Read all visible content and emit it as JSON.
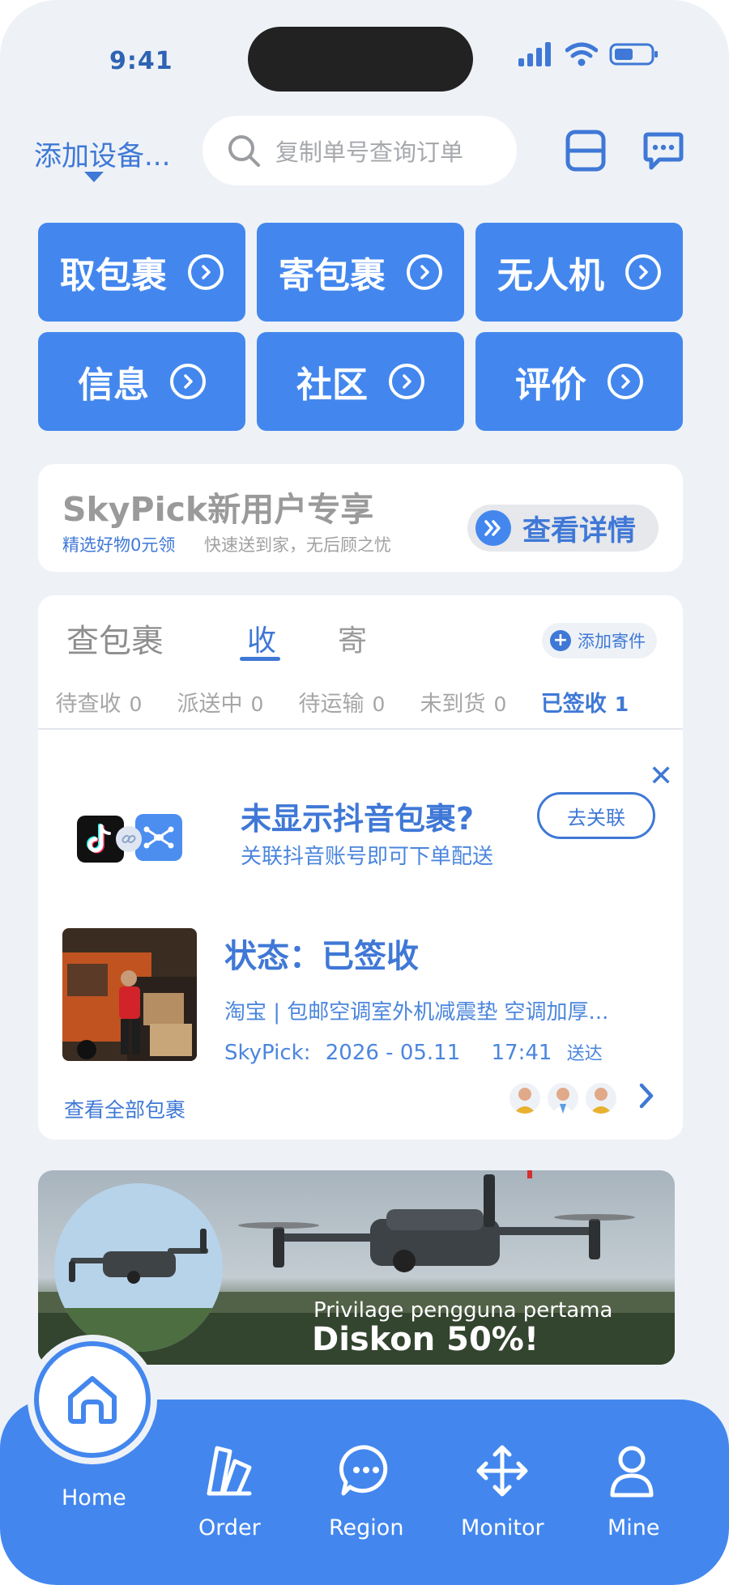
{
  "status_bar": {
    "time": "9:41"
  },
  "top_bar": {
    "add_device": "添加设备...",
    "search_placeholder": "复制单号查询订单"
  },
  "quick_actions": [
    {
      "label": "取包裹"
    },
    {
      "label": "寄包裹"
    },
    {
      "label": "无人机"
    },
    {
      "label": "信息"
    },
    {
      "label": "社区"
    },
    {
      "label": "评价"
    }
  ],
  "promo": {
    "title": "SkyPick新用户专享",
    "subtitle_highlight": "精选好物0元领",
    "subtitle": "快速送到家，无后顾之忧",
    "button": "查看详情"
  },
  "packages": {
    "title": "查包裹",
    "tabs": [
      {
        "label": "收",
        "active": true
      },
      {
        "label": "寄",
        "active": false
      }
    ],
    "add_button": "添加寄件",
    "states": [
      {
        "label": "待查收",
        "count": "0"
      },
      {
        "label": "派送中",
        "count": "0"
      },
      {
        "label": "待运输",
        "count": "0"
      },
      {
        "label": "未到货",
        "count": "0"
      },
      {
        "label": "已签收",
        "count": "1"
      }
    ],
    "douyin": {
      "title": "未显示抖音包裹?",
      "subtitle": "关联抖音账号即可下单配送",
      "button": "去关联"
    },
    "item": {
      "status": "状态：已签收",
      "description": "淘宝 |  包邮空调室外机减震垫 空调加厚...",
      "carrier": "SkyPick:",
      "date": "2026 - 05.11",
      "time": "17:41",
      "delivered": "送达"
    },
    "view_all": "查看全部包裹"
  },
  "banner": {
    "line1": "Privilage pengguna pertama",
    "line2": "Diskon 50%!"
  },
  "nav": [
    {
      "label": "Home",
      "icon": "home-icon"
    },
    {
      "label": "Order",
      "icon": "order-icon"
    },
    {
      "label": "Region",
      "icon": "chat-icon"
    },
    {
      "label": "Monitor",
      "icon": "move-icon"
    },
    {
      "label": "Mine",
      "icon": "user-icon"
    }
  ],
  "colors": {
    "accent": "#4387ee",
    "text_blue": "#3f78d6",
    "background": "#eef2f7"
  }
}
